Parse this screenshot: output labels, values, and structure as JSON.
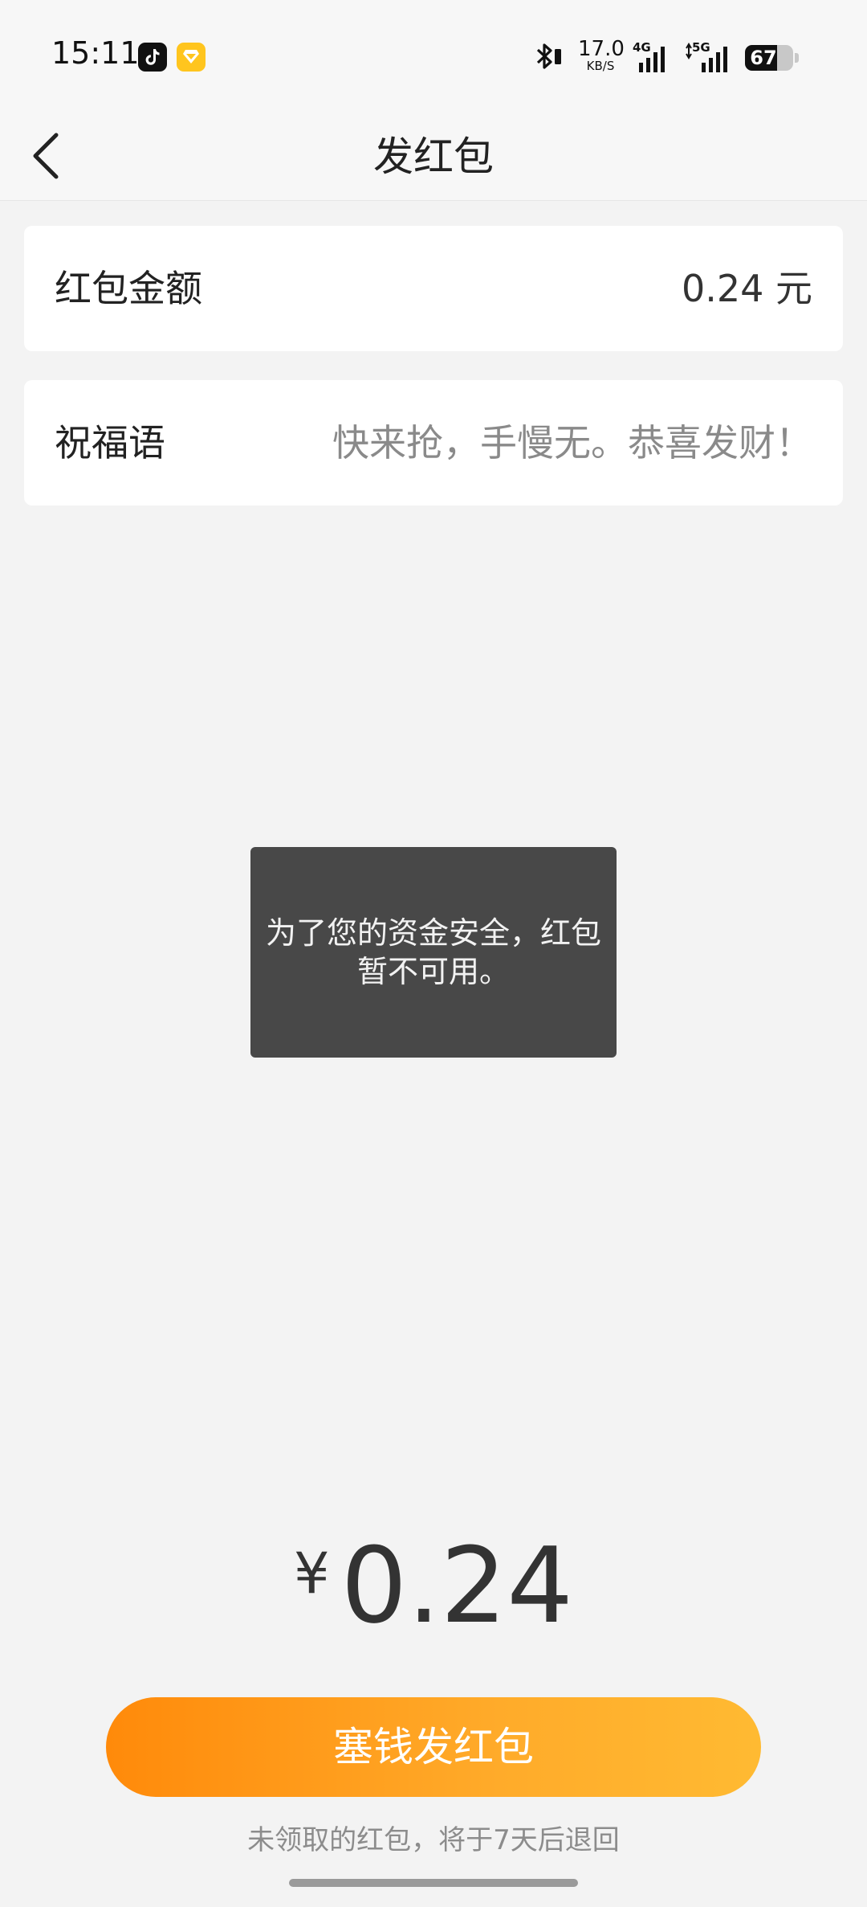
{
  "status_bar": {
    "time": "15:11",
    "apps": [
      "tiktok-icon",
      "yellow-diamond-icon"
    ],
    "net_speed_value": "17.0",
    "net_speed_unit": "KB/S",
    "signal1_label": "4G",
    "signal2_label": "5G",
    "battery_level": "67",
    "battery_fraction": 0.67
  },
  "nav": {
    "title": "发红包",
    "back_icon": "chevron-left-icon"
  },
  "amount_row": {
    "label": "红包金额",
    "value": "0.24 元"
  },
  "greeting_row": {
    "label": "祝福语",
    "placeholder": "快来抢，手慢无。恭喜发财！"
  },
  "toast": {
    "message": "为了您的资金安全，红包暂不可用。"
  },
  "total": {
    "currency_symbol": "¥",
    "amount": "0.24"
  },
  "submit": {
    "label": "塞钱发红包"
  },
  "note": "未领取的红包，将于7天后退回",
  "colors": {
    "accent_start": "#ff8a0a",
    "accent_end": "#ffba32",
    "toast_bg": "#484848",
    "page_bg": "#f3f3f3"
  }
}
